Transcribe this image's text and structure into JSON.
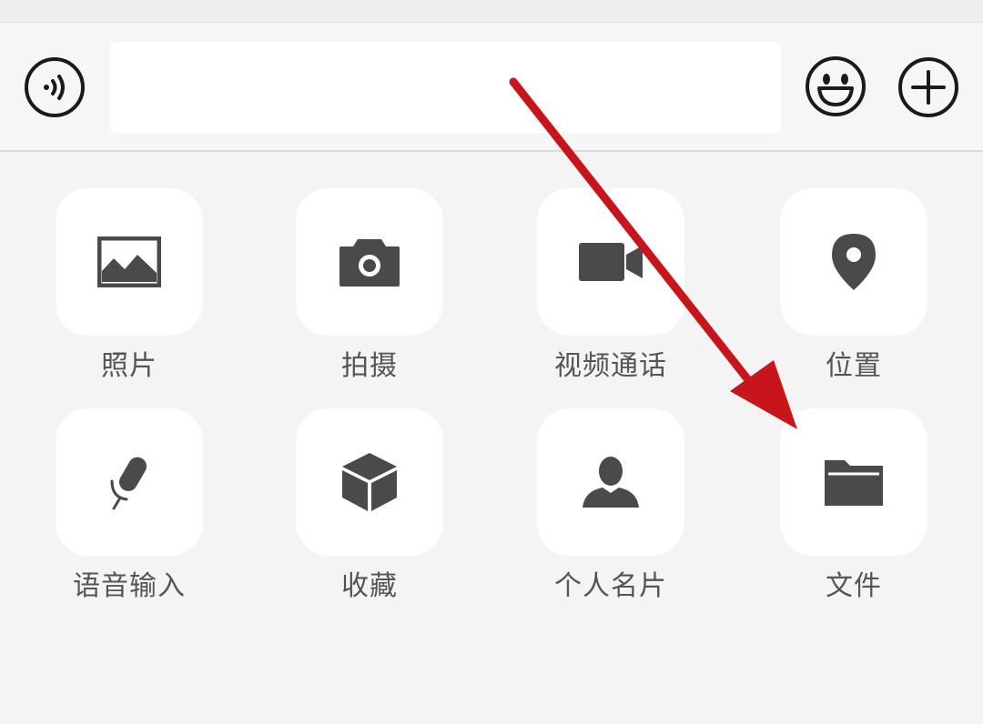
{
  "composer": {
    "message_value": "",
    "icons": {
      "voice": "voice-icon",
      "emoji": "emoji-icon",
      "plus": "plus-circle-icon"
    }
  },
  "actions": [
    {
      "label": "照片",
      "icon": "image-icon"
    },
    {
      "label": "拍摄",
      "icon": "camera-icon"
    },
    {
      "label": "视频通话",
      "icon": "video-camera-icon"
    },
    {
      "label": "位置",
      "icon": "location-pin-icon"
    },
    {
      "label": "语音输入",
      "icon": "microphone-icon"
    },
    {
      "label": "收藏",
      "icon": "box-icon"
    },
    {
      "label": "个人名片",
      "icon": "person-icon"
    },
    {
      "label": "文件",
      "icon": "folder-icon"
    }
  ],
  "colors": {
    "icon": "#4a4a4a",
    "label": "#555555",
    "tile_bg": "#ffffff",
    "panel_bg": "#f4f4f4",
    "annotation_arrow": "#c8151b"
  }
}
